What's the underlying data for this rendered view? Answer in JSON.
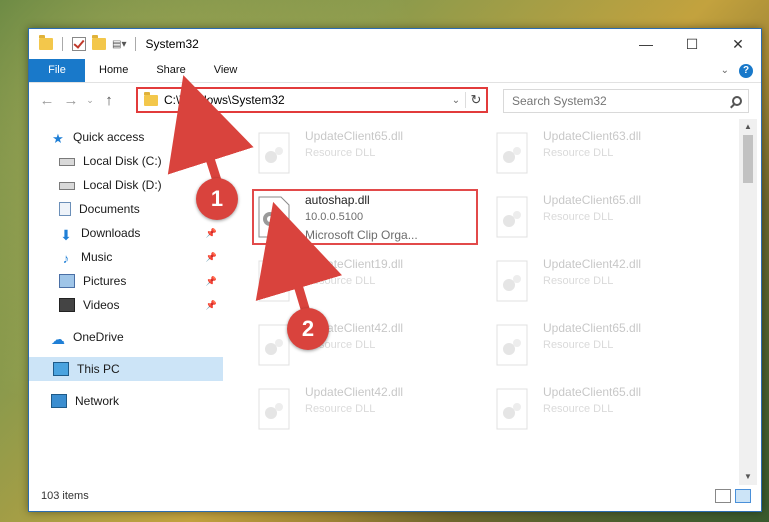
{
  "window": {
    "title": "System32"
  },
  "ribbon": {
    "tabs": [
      "File",
      "Home",
      "Share",
      "View"
    ]
  },
  "address": {
    "path": "C:\\Windows\\System32"
  },
  "search": {
    "placeholder": "Search System32"
  },
  "sidebar": {
    "items": [
      {
        "label": "Quick access",
        "icon": "star-icon",
        "pinned": false
      },
      {
        "label": "Local Disk (C:)",
        "icon": "drive-icon",
        "pinned": false
      },
      {
        "label": "Local Disk (D:)",
        "icon": "drive-icon",
        "pinned": false
      },
      {
        "label": "Documents",
        "icon": "documents-icon",
        "pinned": true
      },
      {
        "label": "Downloads",
        "icon": "downloads-icon",
        "pinned": true
      },
      {
        "label": "Music",
        "icon": "music-icon",
        "pinned": true
      },
      {
        "label": "Pictures",
        "icon": "pictures-icon",
        "pinned": true
      },
      {
        "label": "Videos",
        "icon": "videos-icon",
        "pinned": true
      },
      {
        "label": "OneDrive",
        "icon": "onedrive-icon",
        "pinned": false
      },
      {
        "label": "This PC",
        "icon": "this-pc-icon",
        "pinned": false,
        "selected": true
      },
      {
        "label": "Network",
        "icon": "network-icon",
        "pinned": false
      }
    ]
  },
  "files": [
    {
      "name": "UpdateClient65.dll",
      "type": "Resource DLL",
      "faded": true
    },
    {
      "name": "UpdateClient63.dll",
      "type": "Resource DLL",
      "faded": true
    },
    {
      "name": "autoshap.dll",
      "version": "10.0.0.5100",
      "company": "Microsoft Clip Orga...",
      "faded": false
    },
    {
      "name": "UpdateClient65.dll",
      "type": "Resource DLL",
      "faded": true
    },
    {
      "name": "UpdateClient19.dll",
      "type": "Resource DLL",
      "faded": true
    },
    {
      "name": "UpdateClient42.dll",
      "type": "Resource DLL",
      "faded": true
    },
    {
      "name": "UpdateClient42.dll",
      "type": "Resource DLL",
      "faded": true
    },
    {
      "name": "UpdateClient65.dll",
      "type": "Resource DLL",
      "faded": true
    },
    {
      "name": "UpdateClient42.dll",
      "type": "Resource DLL",
      "faded": true
    },
    {
      "name": "UpdateClient65.dll",
      "type": "Resource DLL",
      "faded": true
    }
  ],
  "status": {
    "item_count": "103 items"
  },
  "annotations": {
    "step1": "1",
    "step2": "2"
  },
  "colors": {
    "accent": "#1979ca",
    "highlight": "#e24a4a",
    "badge": "#d9433d",
    "selected": "#cce4f7"
  }
}
